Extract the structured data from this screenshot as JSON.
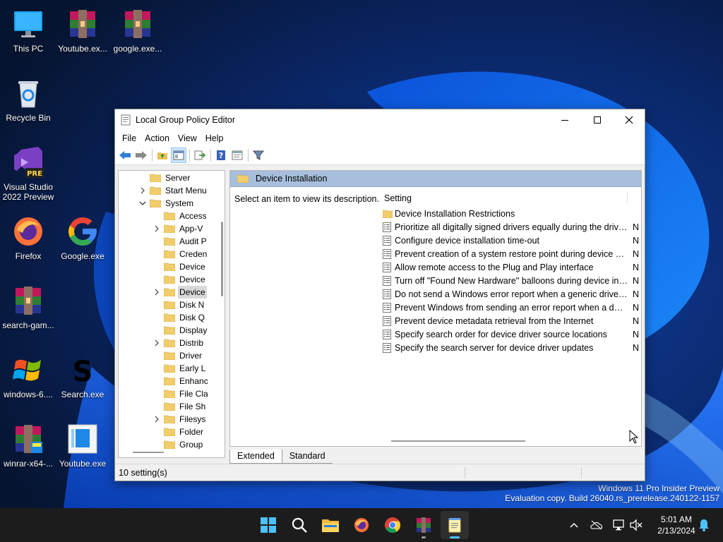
{
  "desktop": {
    "icons": [
      {
        "label": "This PC"
      },
      {
        "label": "Youtube.ex..."
      },
      {
        "label": "google.exe..."
      },
      {
        "label": "Recycle Bin"
      },
      {
        "label": "Visual Studio 2022 Preview",
        "badge": "PRE"
      },
      {
        "label": "Firefox"
      },
      {
        "label": "Google.exe"
      },
      {
        "label": "search-gam..."
      },
      {
        "label": "windows-6...."
      },
      {
        "label": "Search.exe"
      },
      {
        "label": "winrar-x64-..."
      },
      {
        "label": "Youtube.exe"
      }
    ]
  },
  "window": {
    "title": "Local Group Policy Editor",
    "menu": [
      "File",
      "Action",
      "View",
      "Help"
    ],
    "toolbar_icons": [
      "back-icon",
      "forward-icon",
      "up-folder-icon",
      "show-hide-tree-icon",
      "export-list-icon",
      "help-icon",
      "properties-icon",
      "filter-icon"
    ],
    "tree": [
      {
        "label": "Server",
        "indent": 0,
        "expander": "none"
      },
      {
        "label": "Start Menu",
        "indent": 0,
        "expander": "collapsed"
      },
      {
        "label": "System",
        "indent": 0,
        "expander": "expanded"
      },
      {
        "label": "Access",
        "indent": 1,
        "expander": "none"
      },
      {
        "label": "App-V",
        "indent": 1,
        "expander": "collapsed"
      },
      {
        "label": "Audit P",
        "indent": 1,
        "expander": "none"
      },
      {
        "label": "Creden",
        "indent": 1,
        "expander": "none"
      },
      {
        "label": "Device",
        "indent": 1,
        "expander": "none"
      },
      {
        "label": "Device",
        "indent": 1,
        "expander": "none"
      },
      {
        "label": "Device",
        "indent": 1,
        "expander": "collapsed",
        "selected": true
      },
      {
        "label": "Disk N",
        "indent": 1,
        "expander": "none"
      },
      {
        "label": "Disk Q",
        "indent": 1,
        "expander": "none"
      },
      {
        "label": "Display",
        "indent": 1,
        "expander": "none"
      },
      {
        "label": "Distrib",
        "indent": 1,
        "expander": "collapsed"
      },
      {
        "label": "Driver",
        "indent": 1,
        "expander": "none"
      },
      {
        "label": "Early L",
        "indent": 1,
        "expander": "none"
      },
      {
        "label": "Enhanc",
        "indent": 1,
        "expander": "none"
      },
      {
        "label": "File Cla",
        "indent": 1,
        "expander": "none"
      },
      {
        "label": "File Sh",
        "indent": 1,
        "expander": "none"
      },
      {
        "label": "Filesys",
        "indent": 1,
        "expander": "collapsed"
      },
      {
        "label": "Folder",
        "indent": 1,
        "expander": "none"
      },
      {
        "label": "Group",
        "indent": 1,
        "expander": "none"
      }
    ],
    "right_header": "Device Installation",
    "description": "Select an item to view its description.",
    "column_setting": "Setting",
    "rows": [
      {
        "type": "folder",
        "label": "Device Installation Restrictions",
        "state": ""
      },
      {
        "type": "policy",
        "label": "Prioritize all digitally signed drivers equally during the driver ...",
        "state": "N"
      },
      {
        "type": "policy",
        "label": "Configure device installation time-out",
        "state": "N"
      },
      {
        "type": "policy",
        "label": "Prevent creation of a system restore point during device acti...",
        "state": "N"
      },
      {
        "type": "policy",
        "label": "Allow remote access to the Plug and Play interface",
        "state": "N"
      },
      {
        "type": "policy",
        "label": "Turn off \"Found New Hardware\" balloons during device inst...",
        "state": "N"
      },
      {
        "type": "policy",
        "label": "Do not send a Windows error report when a generic driver is...",
        "state": "N"
      },
      {
        "type": "policy",
        "label": "Prevent Windows from sending an error report when a devic...",
        "state": "N"
      },
      {
        "type": "policy",
        "label": "Prevent device metadata retrieval from the Internet",
        "state": "N"
      },
      {
        "type": "policy",
        "label": "Specify search order for device driver source locations",
        "state": "N"
      },
      {
        "type": "policy",
        "label": "Specify the search server for device driver updates",
        "state": "N"
      }
    ],
    "tabs": {
      "extended": "Extended",
      "standard": "Standard"
    },
    "status": "10 setting(s)"
  },
  "watermark": {
    "line1": "Windows 11 Pro Insider Preview",
    "line2": "Evaluation copy. Build 26040.rs_prerelease.240122-1157"
  },
  "taskbar": {
    "apps": [
      "start-icon",
      "search-icon",
      "file-explorer-icon",
      "firefox-icon",
      "chrome-icon",
      "winrar-icon",
      "notepad-icon"
    ],
    "clock_time": "5:01 AM",
    "clock_date": "2/13/2024"
  },
  "colors": {
    "header_blue": "#a7bedc",
    "accent": "#4cc2ff",
    "taskbar": "#1c1c1c"
  }
}
